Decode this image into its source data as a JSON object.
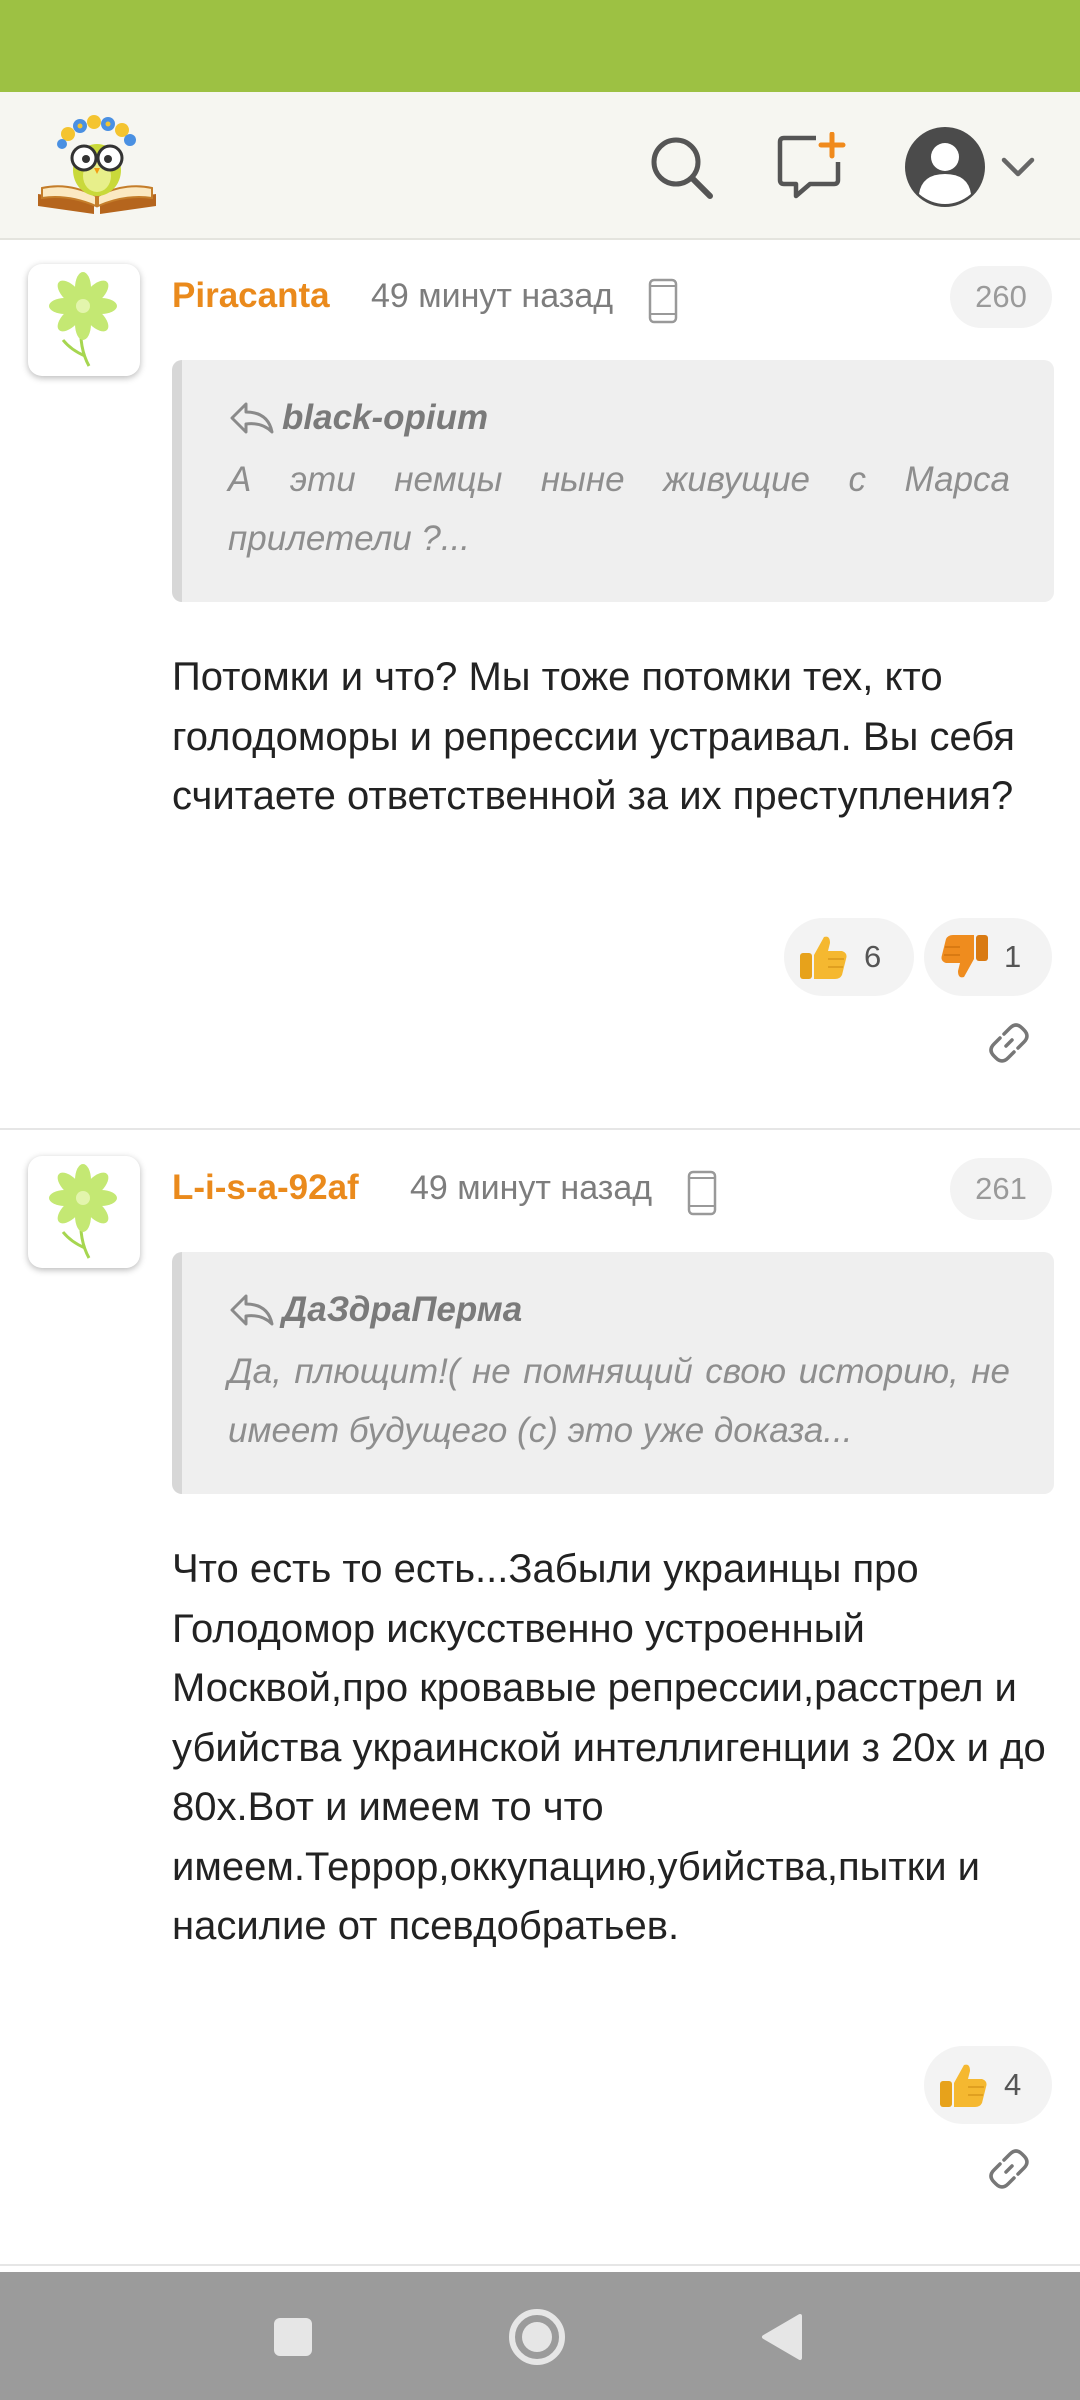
{
  "colors": {
    "status_bar": "#9dc143",
    "author": "#ea8a1c",
    "header_bg": "#f6f6f1",
    "nav_bar": "#9b9b9b",
    "like": "#f5b830",
    "dislike": "#ef8c1e"
  },
  "header": {
    "logo_icon": "owl-on-book-logo",
    "icons": [
      "search-icon",
      "new-message-icon",
      "user-avatar-icon",
      "chevron-down-icon"
    ]
  },
  "comments": [
    {
      "author": "Piracanta",
      "time": "49 минут назад",
      "device_icon": "mobile-phone-icon",
      "number": "260",
      "quote": {
        "author": "black-opium",
        "text": "А эти немцы ныне живущие с Марса прилетели ?..."
      },
      "text": "Потомки и что? Мы тоже потомки тех, кто голодоморы и репрессии устраивал. Вы себя считаете ответственной за их преступления?",
      "likes": "6",
      "dislikes": "1"
    },
    {
      "author": "L-i-s-a-92af",
      "time": "49 минут назад",
      "device_icon": "mobile-phone-icon",
      "number": "261",
      "quote": {
        "author": "ДаЗдраПерма",
        "text": "Да, плющит!( не помнящий свою историю, не имеет будущего (с) это уже доказа..."
      },
      "text": "Что есть то есть...Забыли украинцы про Голодомор искусственно устроенный Москвой,про кровавые репрессии,расстрел и убийства украинской интеллигенции з 20х и до 80х.Вот и имеем то что имеем.Террор,оккупацию,убийства,пытки и насилие от псевдобратьев.",
      "likes": "4"
    }
  ],
  "nav": [
    "recent-apps-icon",
    "home-icon",
    "back-icon"
  ]
}
